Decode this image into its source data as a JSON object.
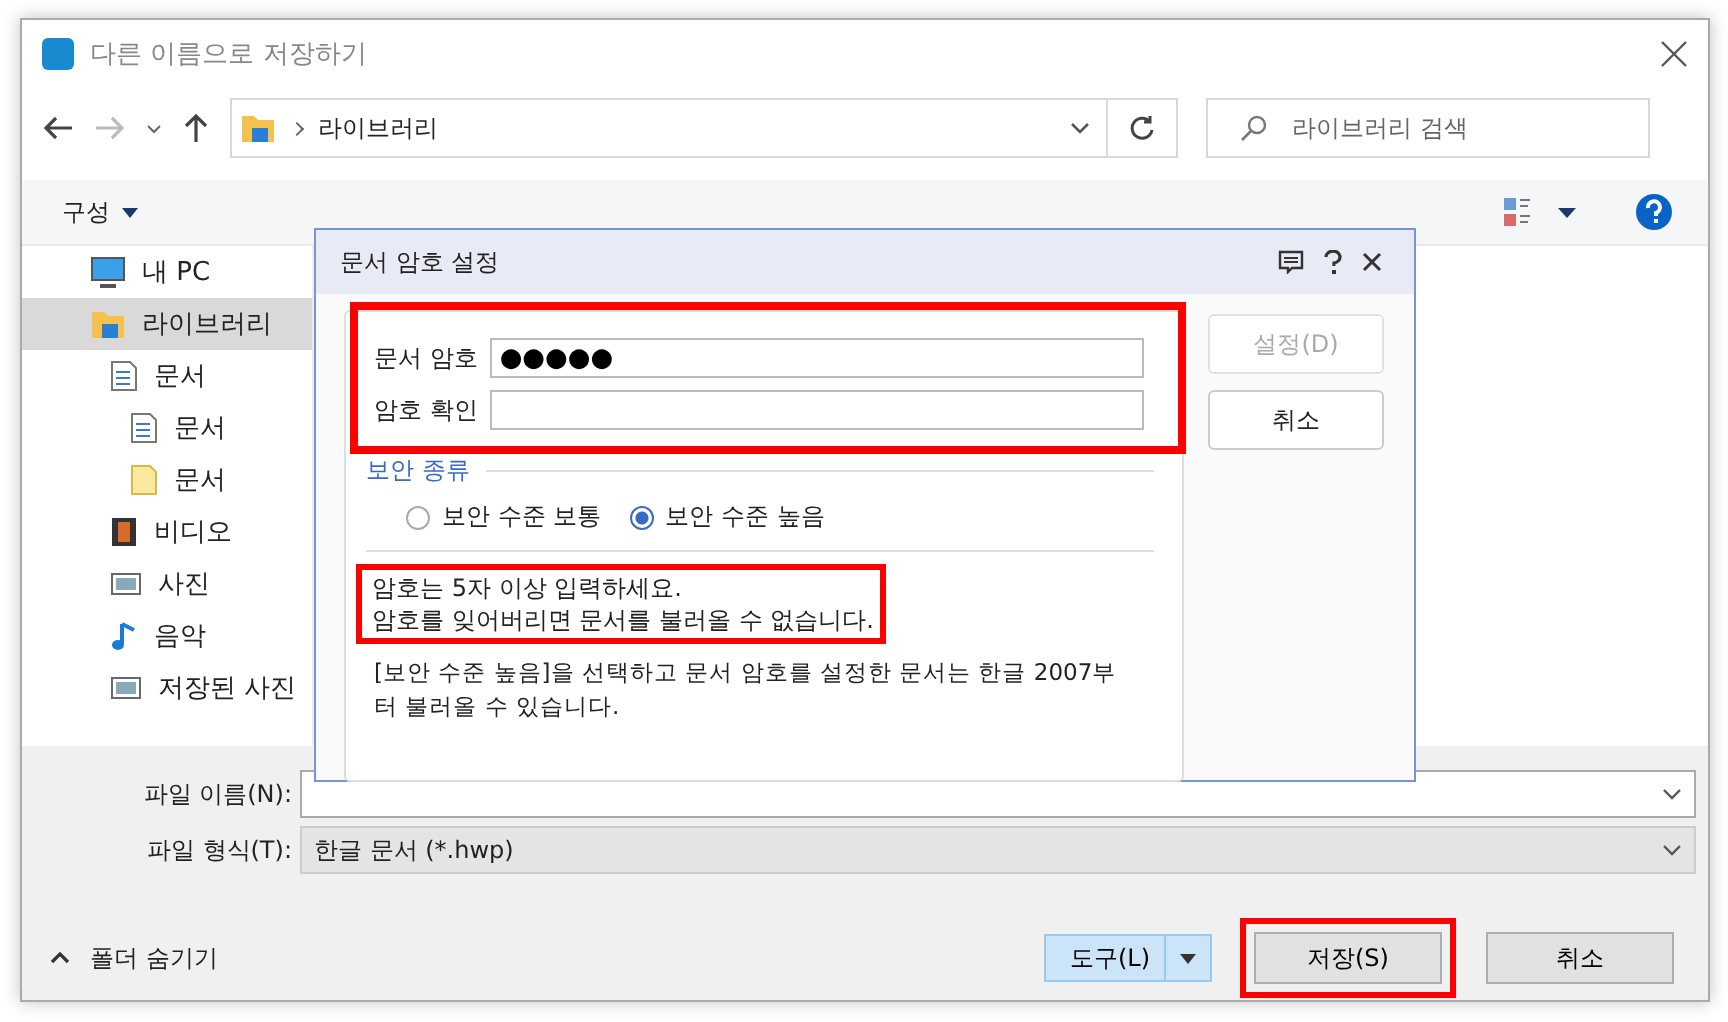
{
  "window": {
    "title": "다른 이름으로 저장하기"
  },
  "nav": {
    "path": "라이브러리",
    "search": {
      "placeholder": "라이브러리 검색"
    }
  },
  "toolbar": {
    "organize": "구성"
  },
  "sidebar": {
    "items": [
      {
        "label": "내 PC",
        "kind": "pc",
        "selected": false
      },
      {
        "label": "라이브러리",
        "kind": "library",
        "selected": true,
        "children": [
          {
            "label": "문서",
            "kind": "documents",
            "selected": false,
            "children": [
              {
                "label": "문서",
                "kind": "documents",
                "selected": false
              },
              {
                "label": "문서",
                "kind": "file",
                "selected": false
              }
            ]
          },
          {
            "label": "비디오",
            "kind": "video",
            "selected": false
          },
          {
            "label": "사진",
            "kind": "pictures",
            "selected": false
          },
          {
            "label": "음악",
            "kind": "music",
            "selected": false
          },
          {
            "label": "저장된 사진",
            "kind": "pictures",
            "selected": false
          }
        ]
      }
    ]
  },
  "password_dialog": {
    "title": "문서 암호 설정",
    "highlighted": true,
    "fields": [
      {
        "label": "문서 암호",
        "value": "●●●●●"
      },
      {
        "label": "암호 확인"
      }
    ],
    "security": {
      "label": "보안 종류",
      "options": [
        {
          "label": "보안 수준 보통",
          "selected": false
        },
        {
          "label": "보안 수준 높음",
          "selected": true
        }
      ]
    },
    "notice": {
      "lines": [
        "암호는 5자 이상 입력하세요.",
        "암호를 잊어버리면 문서를 불러올 수 없습니다."
      ],
      "highlighted": true
    },
    "info": "[보안 수준 높음]을 선택하고 문서 암호를 설정한 문서는 한글 2007부터 불러올 수 있습니다.",
    "buttons": [
      {
        "label": "설정(D)",
        "disabled": true
      },
      {
        "label": "취소",
        "disabled": false
      }
    ]
  },
  "file_form": {
    "name_label": "파일 이름(N):",
    "type_label": "파일 형식(T):",
    "type_value": "한글 문서 (*.hwp)"
  },
  "footer": {
    "hide_folders": "폴더 숨기기",
    "tools": "도구(L)",
    "buttons": [
      {
        "label": "저장(S)",
        "highlighted": true
      },
      {
        "label": "취소",
        "highlighted": false
      }
    ]
  }
}
